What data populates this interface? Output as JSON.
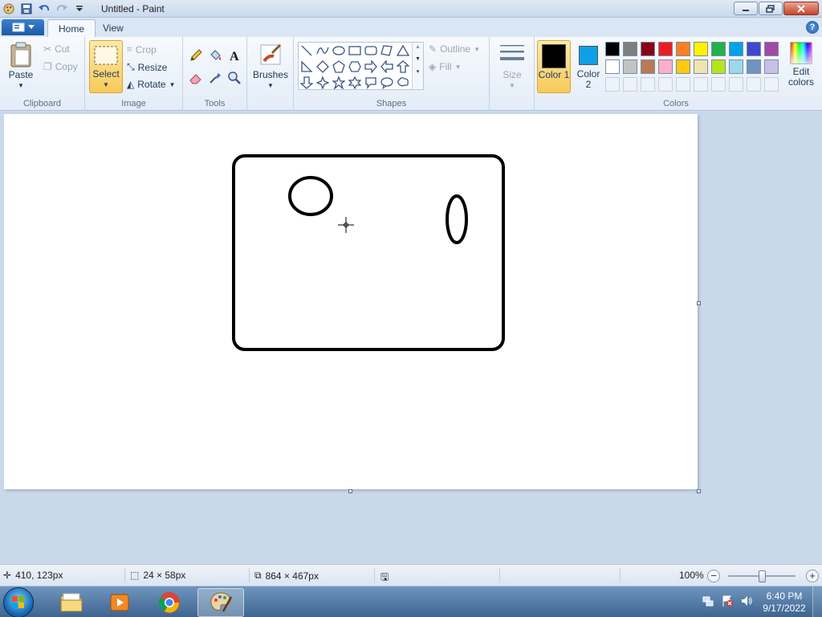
{
  "window": {
    "title": "Untitled - Paint"
  },
  "tabs": [
    {
      "label": "Home",
      "active": true
    },
    {
      "label": "View",
      "active": false
    }
  ],
  "ribbon": {
    "clipboard": {
      "group_label": "Clipboard",
      "paste": "Paste",
      "cut": "Cut",
      "copy": "Copy"
    },
    "image": {
      "group_label": "Image",
      "select": "Select",
      "crop": "Crop",
      "resize": "Resize",
      "rotate": "Rotate"
    },
    "tools": {
      "group_label": "Tools",
      "items": [
        "pencil-icon",
        "fill-bucket-icon",
        "text-icon",
        "eraser-icon",
        "color-picker-icon",
        "magnifier-icon"
      ]
    },
    "brushes": {
      "label": "Brushes"
    },
    "shapes": {
      "group_label": "Shapes",
      "outline": "Outline",
      "fill": "Fill"
    },
    "size": {
      "label": "Size"
    },
    "colors": {
      "group_label": "Colors",
      "color1_label": "Color 1",
      "color2_label": "Color 2",
      "color1": "#000000",
      "color2": "#0ea0e6",
      "edit_colors": "Edit colors",
      "palette_row1": [
        "#000000",
        "#7f7f7f",
        "#880015",
        "#ed1c24",
        "#ff7f27",
        "#fff200",
        "#22b14c",
        "#00a2e8",
        "#3f48cc",
        "#a349a4"
      ],
      "palette_row2": [
        "#ffffff",
        "#c3c3c3",
        "#b97a57",
        "#ffaec9",
        "#ffc90e",
        "#efe4b0",
        "#b5e61d",
        "#99d9ea",
        "#7092be",
        "#c8bfe7"
      ]
    }
  },
  "statusbar": {
    "cursor_pos": "410, 123px",
    "selection_size": "24 × 58px",
    "image_size": "864 × 467px",
    "zoom": "100%"
  },
  "taskbar": {
    "time": "6:40 PM",
    "date": "9/17/2022"
  }
}
